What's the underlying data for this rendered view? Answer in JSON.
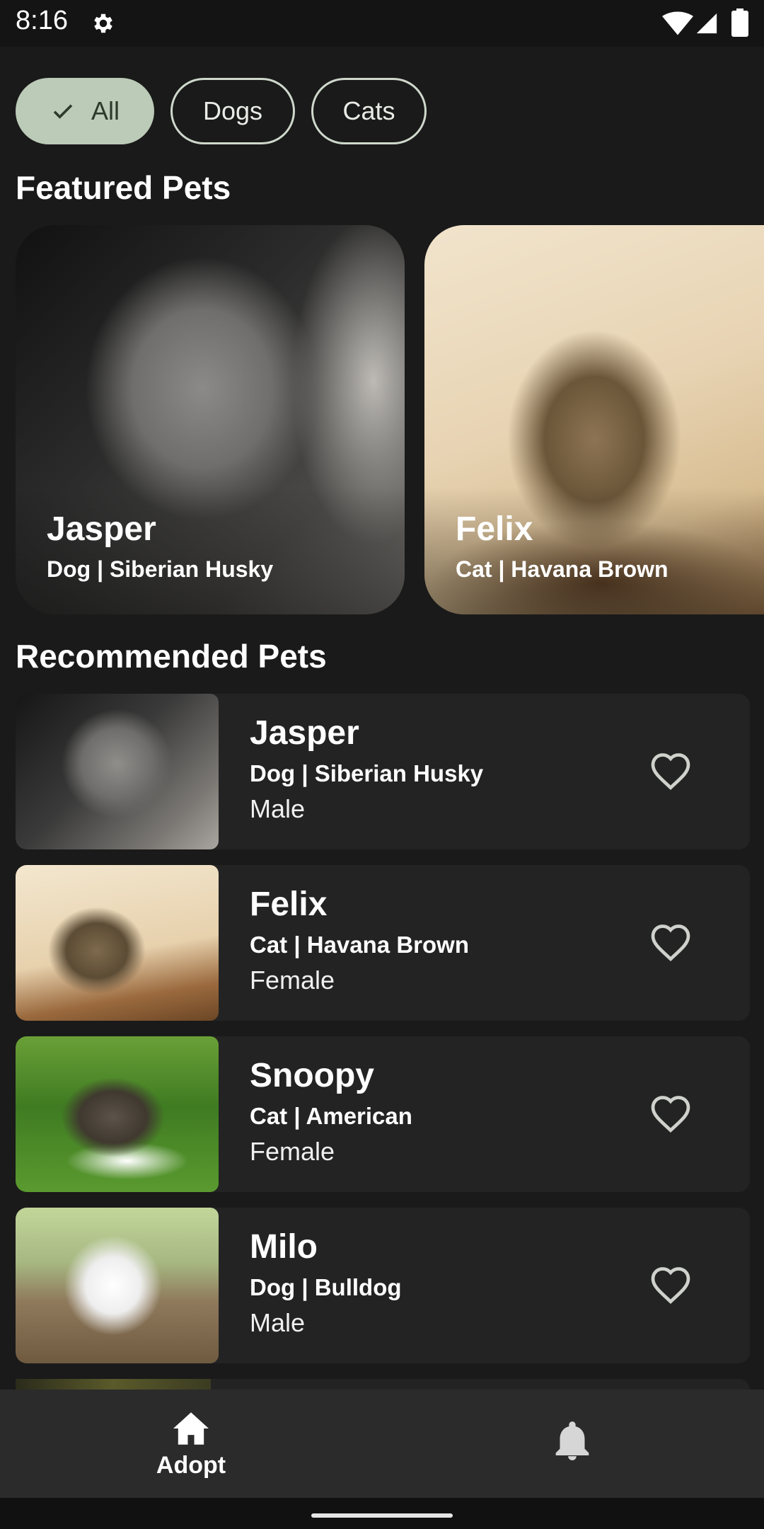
{
  "status_bar": {
    "time": "8:16"
  },
  "filters": [
    {
      "label": "All",
      "selected": true
    },
    {
      "label": "Dogs",
      "selected": false
    },
    {
      "label": "Cats",
      "selected": false
    }
  ],
  "featured": {
    "title": "Featured Pets",
    "items": [
      {
        "name": "Jasper",
        "breed": "Dog | Siberian Husky"
      },
      {
        "name": "Felix",
        "breed": "Cat | Havana Brown"
      }
    ]
  },
  "recommended": {
    "title": "Recommended Pets",
    "items": [
      {
        "name": "Jasper",
        "breed": "Dog | Siberian Husky",
        "gender": "Male"
      },
      {
        "name": "Felix",
        "breed": "Cat | Havana Brown",
        "gender": "Female"
      },
      {
        "name": "Snoopy",
        "breed": "Cat | American",
        "gender": "Female"
      },
      {
        "name": "Milo",
        "breed": "Dog | Bulldog",
        "gender": "Male"
      }
    ]
  },
  "bottom_nav": {
    "items": [
      {
        "label": "Adopt",
        "icon": "home-icon",
        "selected": true
      },
      {
        "label": "",
        "icon": "bell-icon",
        "selected": false
      }
    ]
  },
  "colors": {
    "background": "#1a1a1a",
    "chip_selected": "#bccab8",
    "card": "#232323",
    "nav": "#2b2b2b"
  }
}
